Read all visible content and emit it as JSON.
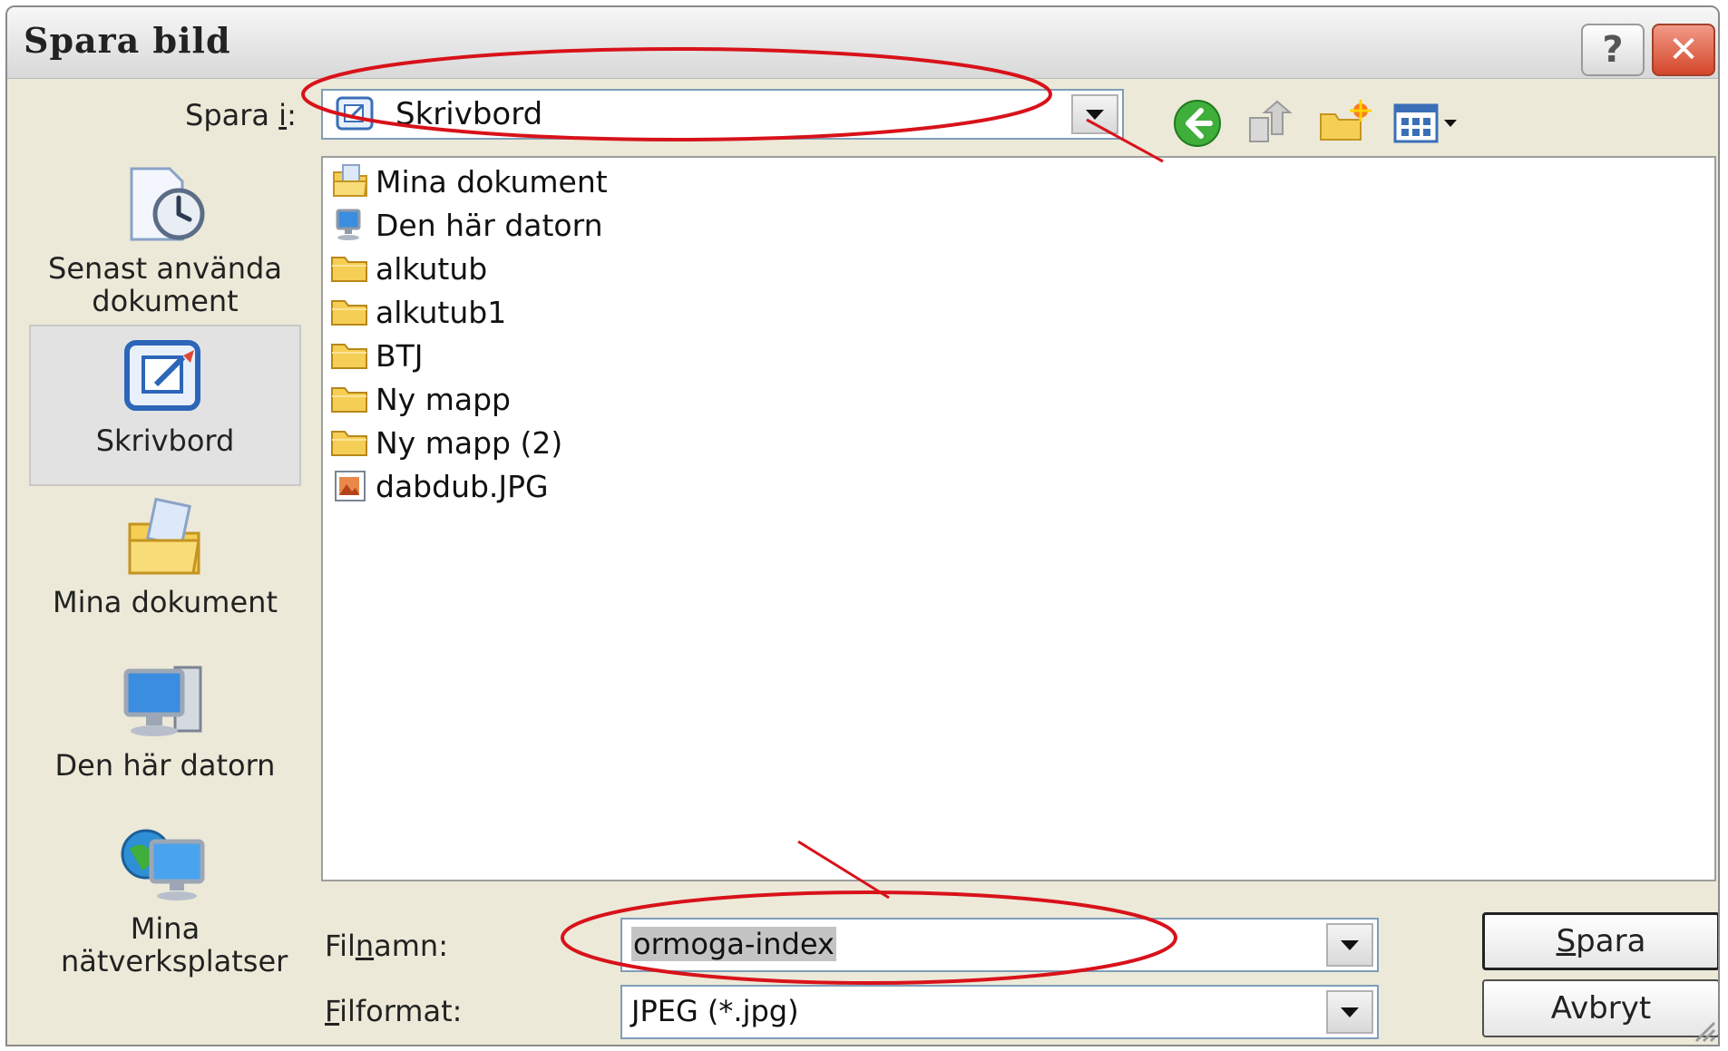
{
  "window": {
    "title": "Spara bild",
    "help_label": "?",
    "close_label": "✕"
  },
  "location": {
    "label_prefix": "Spara ",
    "label_accel": "i",
    "label_suffix": ":",
    "current": "Skrivbord"
  },
  "toolbar_icons": [
    "back-icon",
    "up-folder-icon",
    "new-folder-icon",
    "view-menu-icon"
  ],
  "places": [
    {
      "label": "Senast använda dokument",
      "icon": "recent-documents-icon"
    },
    {
      "label": "Skrivbord",
      "icon": "desktop-icon",
      "selected": true
    },
    {
      "label": "Mina dokument",
      "icon": "my-documents-icon"
    },
    {
      "label": "Den här datorn",
      "icon": "my-computer-icon"
    },
    {
      "label": "Mina nätverksplatser",
      "icon": "network-places-icon"
    }
  ],
  "files": [
    {
      "name": "Mina dokument",
      "icon": "my-documents-icon"
    },
    {
      "name": "Den här datorn",
      "icon": "my-computer-icon"
    },
    {
      "name": "alkutub",
      "icon": "folder-icon"
    },
    {
      "name": "alkutub1",
      "icon": "folder-icon"
    },
    {
      "name": "BTJ",
      "icon": "folder-icon"
    },
    {
      "name": "Ny mapp",
      "icon": "folder-icon"
    },
    {
      "name": "Ny mapp (2)",
      "icon": "folder-icon"
    },
    {
      "name": "dabdub.JPG",
      "icon": "image-file-icon"
    }
  ],
  "filename": {
    "label_pre": "Fil",
    "label_accel": "n",
    "label_post": "amn:",
    "value": "ormoga-index"
  },
  "filetype": {
    "label_accel": "F",
    "label_post": "ilformat:",
    "value": "JPEG (*.jpg)"
  },
  "buttons": {
    "save_accel": "S",
    "save_rest": "para",
    "cancel": "Avbryt"
  },
  "annotation_color": "#d8121a"
}
